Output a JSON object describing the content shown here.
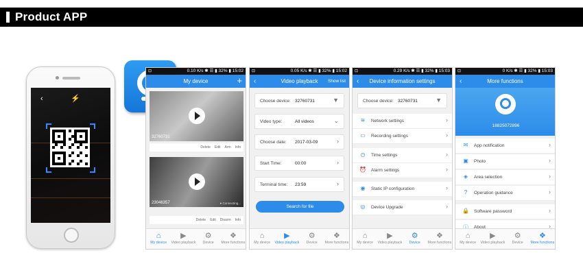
{
  "header": {
    "title": "Product APP"
  },
  "screen1": {
    "status": {
      "left": "⊡",
      "right": "0.10 K/s ✱ ☰ ▮ 32% ▮ 15:02"
    },
    "title": "My device",
    "cameras": [
      {
        "id": "32760731",
        "status": "",
        "actions": [
          "Delete",
          "Edit",
          "Arm",
          "Info"
        ]
      },
      {
        "id": "23046357",
        "status": "● Connecting...",
        "actions": [
          "Delete",
          "Edit",
          "Disarm",
          "Info"
        ]
      }
    ],
    "nav": [
      {
        "icon": "⌂",
        "label": "My device",
        "active": true
      },
      {
        "icon": "▶",
        "label": "Video playback",
        "active": false
      },
      {
        "icon": "⚙",
        "label": "Device",
        "active": false
      },
      {
        "icon": "❖",
        "label": "More functions",
        "active": false
      }
    ]
  },
  "screen2": {
    "status": {
      "left": "⊡",
      "right": "0.05 K/s ✱ ☰ ▮ 32% ▮ 15:02"
    },
    "title": "Video playback",
    "right_link": "Show list",
    "rows": [
      {
        "label": "Choose device:",
        "value": "32760731",
        "arrow": "▼"
      },
      {
        "label": "Video type:",
        "value": "All videos",
        "arrow": "⌄"
      },
      {
        "label": "Choose date:",
        "value": "2017-03-09",
        "arrow": "›"
      },
      {
        "label": "Start Time:",
        "value": "00:00",
        "arrow": "›"
      },
      {
        "label": "Terminal time:",
        "value": "23:59",
        "arrow": "›"
      }
    ],
    "button": "Search for file",
    "nav": [
      {
        "icon": "⌂",
        "label": "My device",
        "active": false
      },
      {
        "icon": "▶",
        "label": "Video playback",
        "active": true
      },
      {
        "icon": "⚙",
        "label": "Device",
        "active": false
      },
      {
        "icon": "❖",
        "label": "More functions",
        "active": false
      }
    ]
  },
  "screen3": {
    "status": {
      "left": "⊡",
      "right": "0.29 K/s ✱ ☰ ▮ 32% ▮ 15:03"
    },
    "title": "Device information settings",
    "device_row": {
      "label": "Choose device:",
      "value": "32760731",
      "arrow": "▼"
    },
    "items": [
      {
        "icon": "≋",
        "label": "Network settings"
      },
      {
        "icon": "▭",
        "label": "Recording settings"
      },
      {
        "icon": "◷",
        "label": "Time settings"
      },
      {
        "icon": "⏰",
        "label": "Alarm settings"
      },
      {
        "icon": "◉",
        "label": "Static IP configuration"
      },
      {
        "icon": "◎",
        "label": "Device Upgrade"
      }
    ],
    "nav": [
      {
        "icon": "⌂",
        "label": "My device",
        "active": false
      },
      {
        "icon": "▶",
        "label": "Video playback",
        "active": false
      },
      {
        "icon": "⚙",
        "label": "Device",
        "active": true
      },
      {
        "icon": "❖",
        "label": "More functions",
        "active": false
      }
    ]
  },
  "screen4": {
    "status": {
      "left": "⊡",
      "right": "0 K/s ✱ ☰ ▮ 32% ▮ 15:03"
    },
    "title": "More functions",
    "phone": "18825072896",
    "items": [
      {
        "icon": "✉",
        "label": "App notification"
      },
      {
        "icon": "▣",
        "label": "Photo"
      },
      {
        "icon": "◈",
        "label": "Area selection"
      },
      {
        "icon": "?",
        "label": "Operation guidance"
      },
      {
        "icon": "🔒",
        "label": "Software password"
      },
      {
        "icon": "ⓘ",
        "label": "About"
      }
    ],
    "nav": [
      {
        "icon": "⌂",
        "label": "My device",
        "active": false
      },
      {
        "icon": "▶",
        "label": "Video playback",
        "active": false
      },
      {
        "icon": "⚙",
        "label": "Device",
        "active": false
      },
      {
        "icon": "❖",
        "label": "More functions",
        "active": true
      }
    ]
  },
  "colors": {
    "accent": "#2d8cea",
    "header": "#000000"
  }
}
